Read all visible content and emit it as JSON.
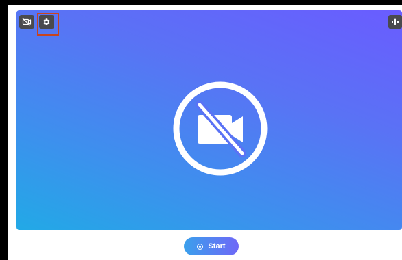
{
  "video_controls": {
    "camera_toggle_icon": "video-off-icon",
    "settings_icon": "gear-icon",
    "audio_level_icon": "audio-level-icon"
  },
  "video_area": {
    "placeholder_icon": "video-off-icon",
    "gradient_colors": [
      "#6a5cff",
      "#22a9e6"
    ]
  },
  "start_button": {
    "label": "Start",
    "icon": "record-icon"
  },
  "colors": {
    "highlight": "#c8441e",
    "control_bg": "#4a4a4e"
  }
}
